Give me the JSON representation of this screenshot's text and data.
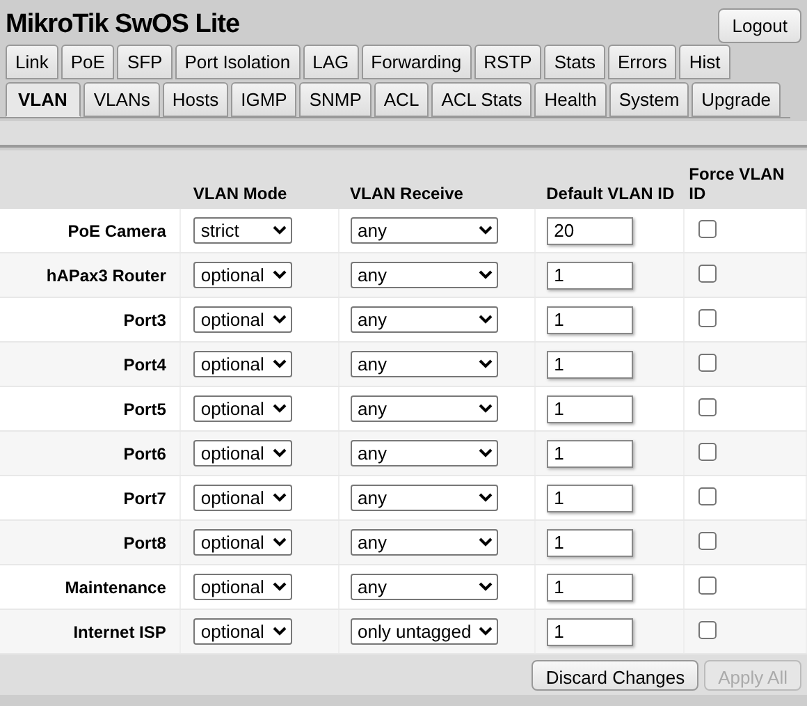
{
  "window": {
    "title": "MikroTik SwOS Lite"
  },
  "logout": "Logout",
  "tab_rows": [
    [
      {
        "label": "Link",
        "selected": false
      },
      {
        "label": "PoE",
        "selected": false
      },
      {
        "label": "SFP",
        "selected": false
      },
      {
        "label": "Port Isolation",
        "selected": false
      },
      {
        "label": "LAG",
        "selected": false
      },
      {
        "label": "Forwarding",
        "selected": false
      },
      {
        "label": "RSTP",
        "selected": false
      },
      {
        "label": "Stats",
        "selected": false
      },
      {
        "label": "Errors",
        "selected": false
      },
      {
        "label": "Hist",
        "selected": false
      }
    ],
    [
      {
        "label": "VLAN",
        "selected": true
      },
      {
        "label": "VLANs",
        "selected": false
      },
      {
        "label": "Hosts",
        "selected": false
      },
      {
        "label": "IGMP",
        "selected": false
      },
      {
        "label": "SNMP",
        "selected": false
      },
      {
        "label": "ACL",
        "selected": false
      },
      {
        "label": "ACL Stats",
        "selected": false
      },
      {
        "label": "Health",
        "selected": false
      },
      {
        "label": "System",
        "selected": false
      },
      {
        "label": "Upgrade",
        "selected": false
      }
    ]
  ],
  "table": {
    "columns": [
      "VLAN Mode",
      "VLAN Receive",
      "Default VLAN ID",
      "Force VLAN ID"
    ],
    "rows": [
      {
        "port": "PoE Camera",
        "vlan_mode": "strict",
        "vlan_receive": "any",
        "default_vlan_id": "20",
        "force_vlan_id": false
      },
      {
        "port": "hAPax3 Router",
        "vlan_mode": "optional",
        "vlan_receive": "any",
        "default_vlan_id": "1",
        "force_vlan_id": false
      },
      {
        "port": "Port3",
        "vlan_mode": "optional",
        "vlan_receive": "any",
        "default_vlan_id": "1",
        "force_vlan_id": false
      },
      {
        "port": "Port4",
        "vlan_mode": "optional",
        "vlan_receive": "any",
        "default_vlan_id": "1",
        "force_vlan_id": false
      },
      {
        "port": "Port5",
        "vlan_mode": "optional",
        "vlan_receive": "any",
        "default_vlan_id": "1",
        "force_vlan_id": false
      },
      {
        "port": "Port6",
        "vlan_mode": "optional",
        "vlan_receive": "any",
        "default_vlan_id": "1",
        "force_vlan_id": false
      },
      {
        "port": "Port7",
        "vlan_mode": "optional",
        "vlan_receive": "any",
        "default_vlan_id": "1",
        "force_vlan_id": false
      },
      {
        "port": "Port8",
        "vlan_mode": "optional",
        "vlan_receive": "any",
        "default_vlan_id": "1",
        "force_vlan_id": false
      },
      {
        "port": "Maintenance",
        "vlan_mode": "optional",
        "vlan_receive": "any",
        "default_vlan_id": "1",
        "force_vlan_id": false
      },
      {
        "port": "Internet ISP",
        "vlan_mode": "optional",
        "vlan_receive": "only untagged",
        "default_vlan_id": "1",
        "force_vlan_id": false
      }
    ]
  },
  "buttons": [
    {
      "label": "Discard Changes",
      "disabled": false
    },
    {
      "label": "Apply All",
      "disabled": true
    }
  ]
}
